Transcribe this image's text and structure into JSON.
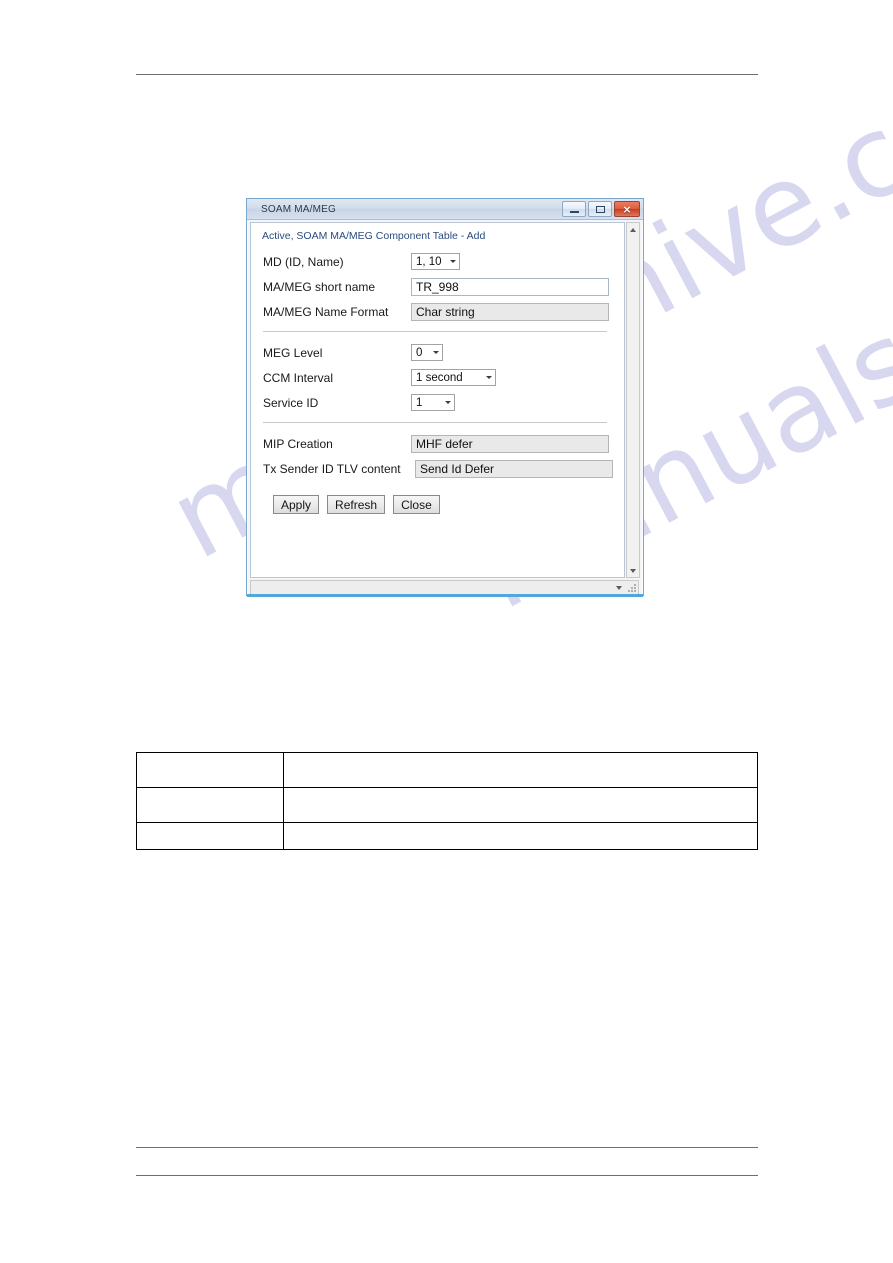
{
  "document": {
    "watermark_lines": [
      "manualshive.com",
      "manualshive.com"
    ],
    "header_rule": true,
    "footer_rules": 2
  },
  "window": {
    "title": "SOAM MA/MEG",
    "controls": {
      "minimize": "minimize-icon",
      "maximize": "maximize-icon",
      "close": "close-icon",
      "close_label": "×"
    }
  },
  "form": {
    "heading": "Active, SOAM MA/MEG Component Table - Add",
    "fields": [
      {
        "label": "MD (ID, Name)",
        "type": "combo",
        "value": "1, 10"
      },
      {
        "label": "MA/MEG short name",
        "type": "text",
        "value": "TR_998"
      },
      {
        "label": "MA/MEG Name Format",
        "type": "text-readonly",
        "value": "Char string"
      },
      {
        "label": "MEG Level",
        "type": "combo",
        "value": "0"
      },
      {
        "label": "CCM Interval",
        "type": "combo",
        "value": "1 second"
      },
      {
        "label": "Service ID",
        "type": "combo",
        "value": "1"
      },
      {
        "label": "MIP Creation",
        "type": "text-readonly",
        "value": "MHF defer"
      },
      {
        "label": "Tx Sender ID TLV content",
        "type": "text-readonly",
        "value": "Send Id Defer"
      }
    ],
    "buttons": [
      {
        "label": "Apply",
        "name": "apply-button"
      },
      {
        "label": "Refresh",
        "name": "refresh-button"
      },
      {
        "label": "Close",
        "name": "close-button"
      }
    ]
  },
  "scrollbars": {
    "vertical": {
      "up": "scroll-up-arrow",
      "down": "scroll-down-arrow"
    },
    "horizontal": {
      "down": "scroll-down-arrow"
    }
  },
  "doc_table": {
    "rows": [
      {
        "cells": [
          "",
          ""
        ]
      },
      {
        "cells": [
          "",
          ""
        ]
      },
      {
        "cells": [
          "",
          ""
        ]
      }
    ]
  },
  "colors": {
    "accent": "#2a4c7d",
    "title_bar": "#d2dceb",
    "close_button": "#de5c3c",
    "status_bar": "#51a7da",
    "watermark": "#b9b7e4"
  }
}
